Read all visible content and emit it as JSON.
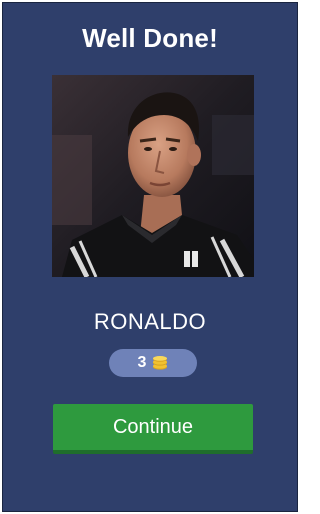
{
  "header": {
    "title": "Well Done!"
  },
  "result": {
    "player_name": "RONALDO",
    "photo_icon": "player-photo"
  },
  "reward": {
    "coins": "3",
    "icon": "coin-stack-icon"
  },
  "actions": {
    "continue_label": "Continue"
  },
  "colors": {
    "background": "#2f3f6b",
    "badge": "#6f82b8",
    "button": "#2e9a3e",
    "coin": "#f2c230"
  }
}
